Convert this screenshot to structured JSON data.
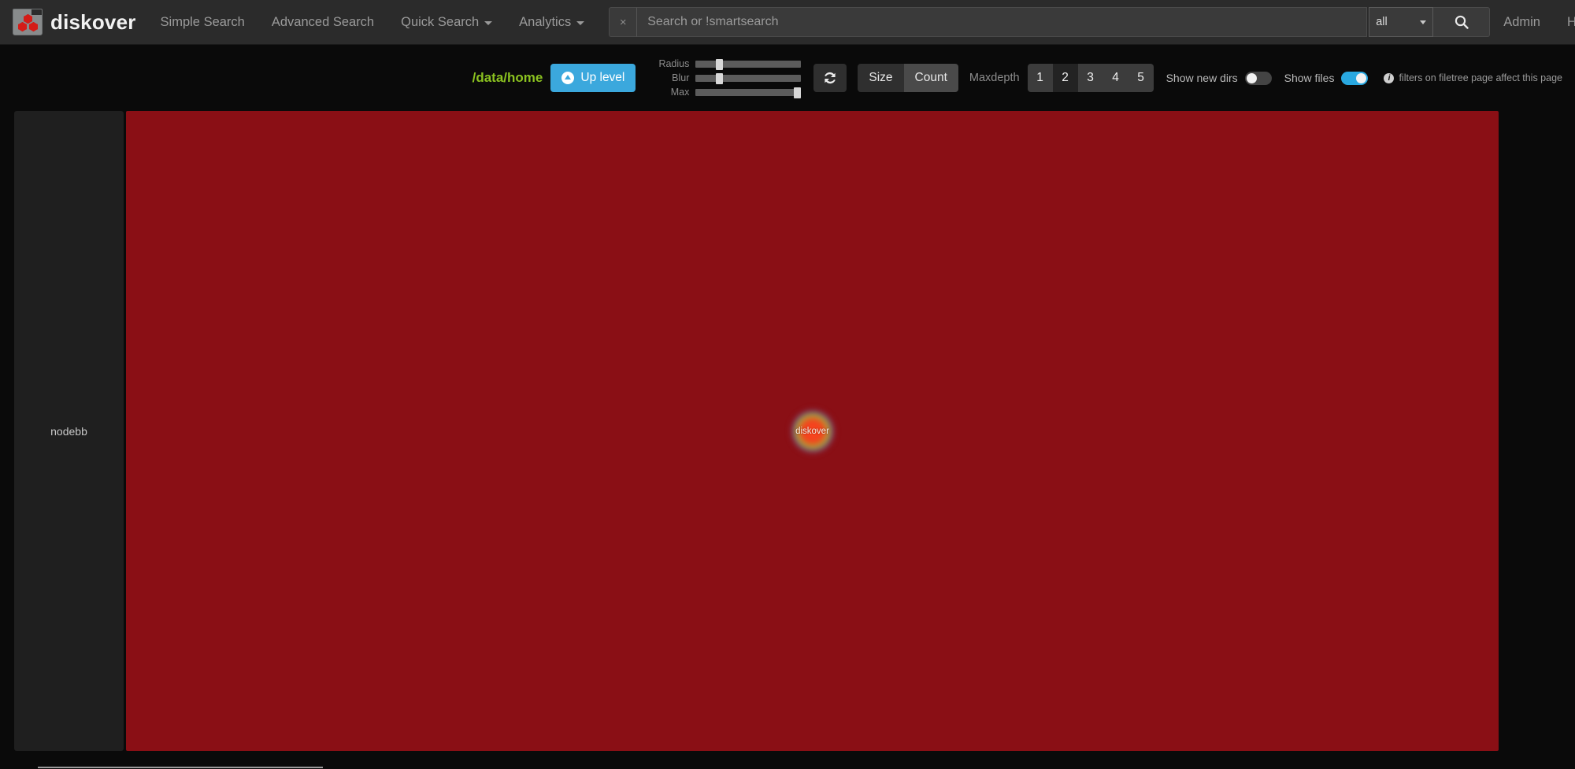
{
  "navbar": {
    "brand": "diskover",
    "logo_icon": "diskover-folder-logo-icon",
    "links": [
      {
        "label": "Simple Search",
        "has_caret": false
      },
      {
        "label": "Advanced Search",
        "has_caret": false
      },
      {
        "label": "Quick Search",
        "has_caret": true
      },
      {
        "label": "Analytics",
        "has_caret": true
      }
    ],
    "search": {
      "clear_label": "×",
      "value": "",
      "placeholder": "Search or !smartsearch",
      "select_value": "all",
      "search_icon": "search-icon"
    },
    "right_links": [
      {
        "label": "Admin"
      },
      {
        "label": "Help"
      }
    ],
    "github_icon": "github-icon"
  },
  "toolbar": {
    "path": "/data/home",
    "uplevel_label": "Up level",
    "sliders": [
      {
        "label": "Radius",
        "percent": 22
      },
      {
        "label": "Blur",
        "percent": 22
      },
      {
        "label": "Max",
        "percent": 96
      }
    ],
    "refresh_icon": "refresh-icon",
    "metric_buttons": [
      {
        "label": "Size",
        "active": false
      },
      {
        "label": "Count",
        "active": true
      }
    ],
    "maxdepth_label": "Maxdepth",
    "depth_buttons": [
      {
        "label": "1",
        "pressed": false
      },
      {
        "label": "2",
        "pressed": true
      },
      {
        "label": "3",
        "pressed": false
      },
      {
        "label": "4",
        "pressed": false
      },
      {
        "label": "5",
        "pressed": false
      }
    ],
    "toggles": [
      {
        "label": "Show new dirs",
        "on": false
      },
      {
        "label": "Show files",
        "on": true
      }
    ],
    "note": "filters on filetree page affect this page",
    "note_icon": "info-icon"
  },
  "sidebar": {
    "items": [
      {
        "label": "nodebb"
      }
    ]
  },
  "heatmap": {
    "background_color": "#8a0f15",
    "blobs": [
      {
        "label": "diskover",
        "x_percent": 50,
        "y_percent": 50
      }
    ]
  }
}
